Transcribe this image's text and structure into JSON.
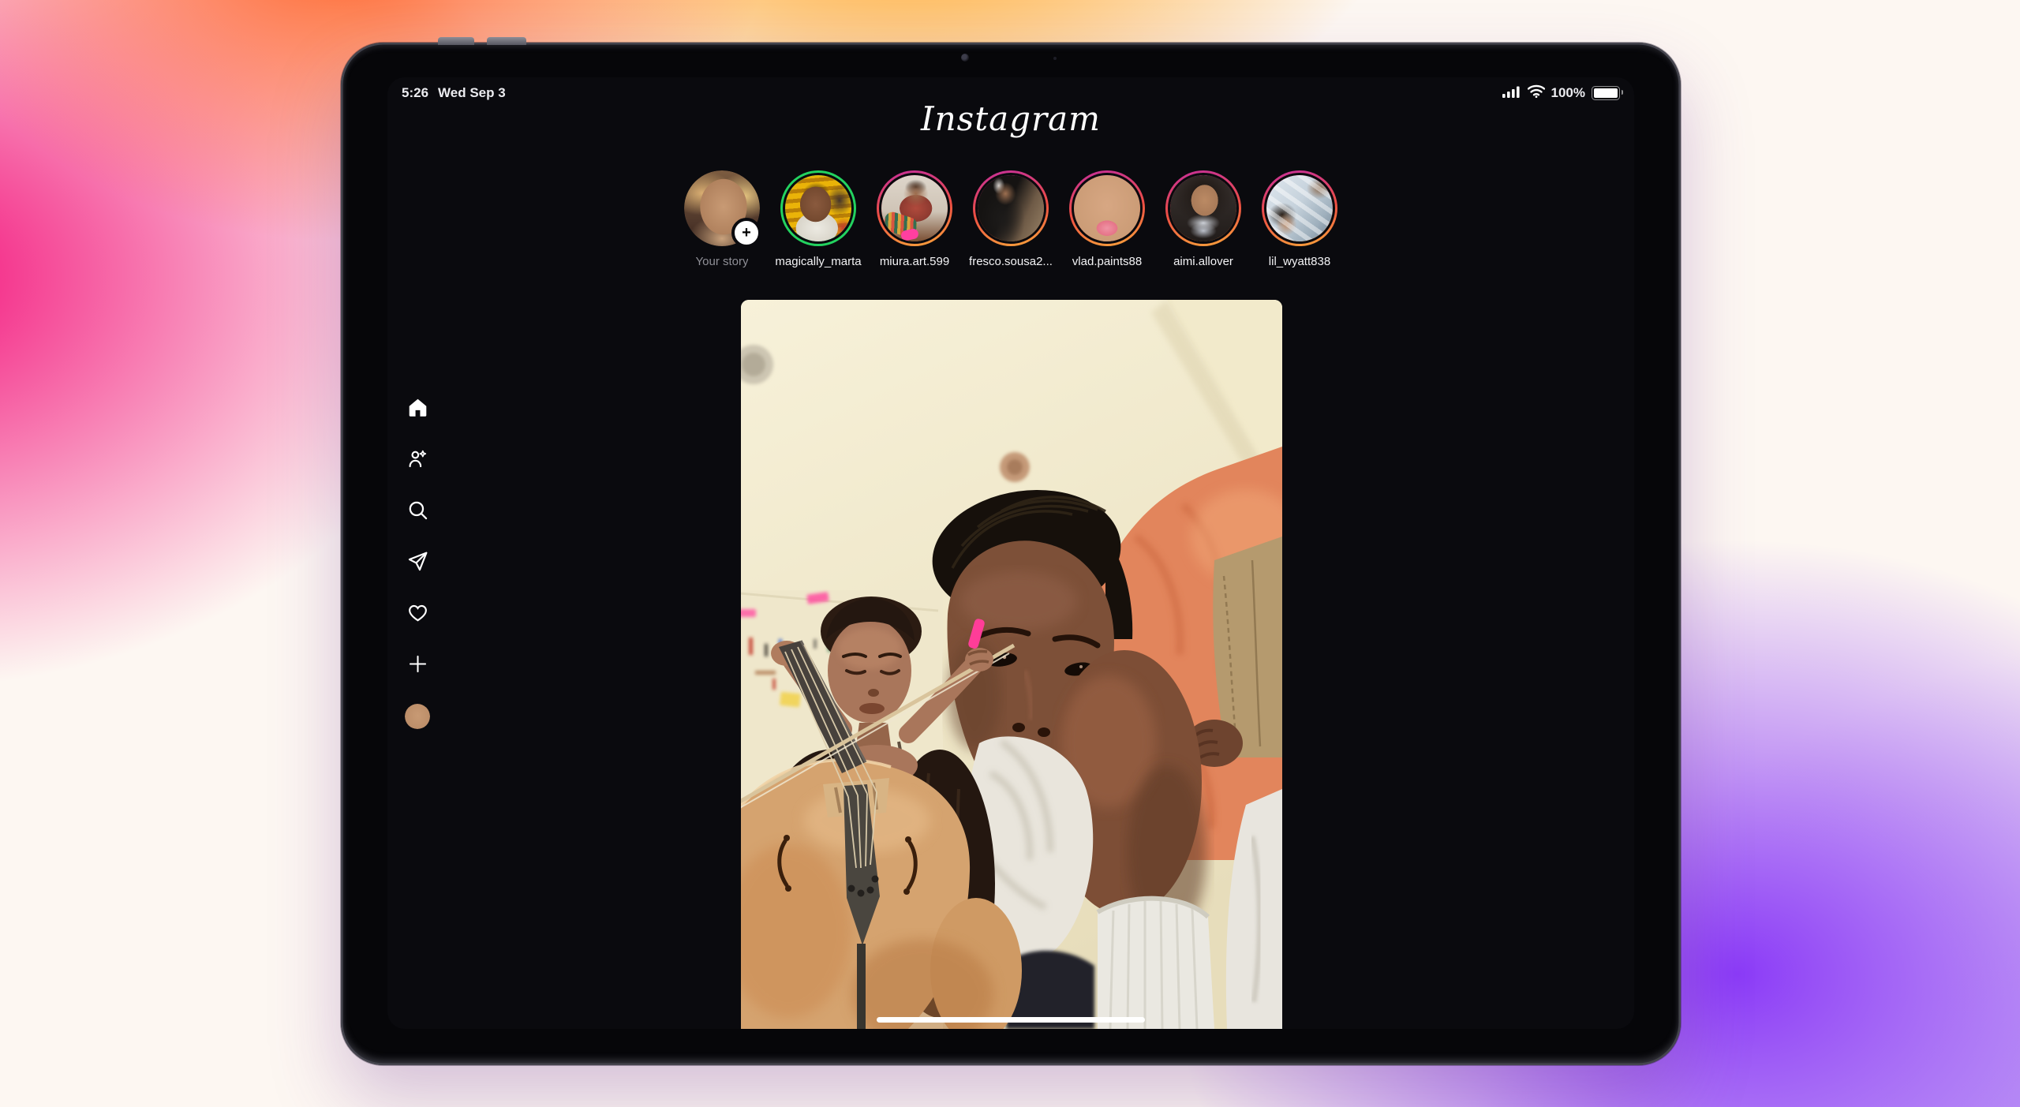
{
  "device": {
    "name": "iPad"
  },
  "status_bar": {
    "time": "5:26",
    "date": "Wed Sep 3",
    "battery_percent": "100%",
    "icons": [
      "cellular-signal",
      "wifi",
      "battery"
    ]
  },
  "app": {
    "wordmark": "Instagram"
  },
  "stories": {
    "add_badge_glyph": "+",
    "items": [
      {
        "username": "Your story",
        "ring": "none",
        "has_add_badge": true
      },
      {
        "username": "magically_marta",
        "ring": "green"
      },
      {
        "username": "miura.art.599",
        "ring": "gradient"
      },
      {
        "username": "fresco.sousa2...",
        "ring": "gradient"
      },
      {
        "username": "vlad.paints88",
        "ring": "gradient"
      },
      {
        "username": "aimi.allover",
        "ring": "gradient"
      },
      {
        "username": "lil_wyatt838",
        "ring": "gradient"
      }
    ]
  },
  "sidebar": {
    "items": [
      {
        "name": "home"
      },
      {
        "name": "friends"
      },
      {
        "name": "search"
      },
      {
        "name": "messages"
      },
      {
        "name": "notifications"
      },
      {
        "name": "create"
      },
      {
        "name": "profile"
      }
    ]
  },
  "colors": {
    "story_ring_top": "#c52e9b",
    "story_ring_bottom": "#f8a43a",
    "close_friends_ring": "#23d35f",
    "screen_bg": "#0a0a0e",
    "home_indicator": "#ffffff"
  }
}
